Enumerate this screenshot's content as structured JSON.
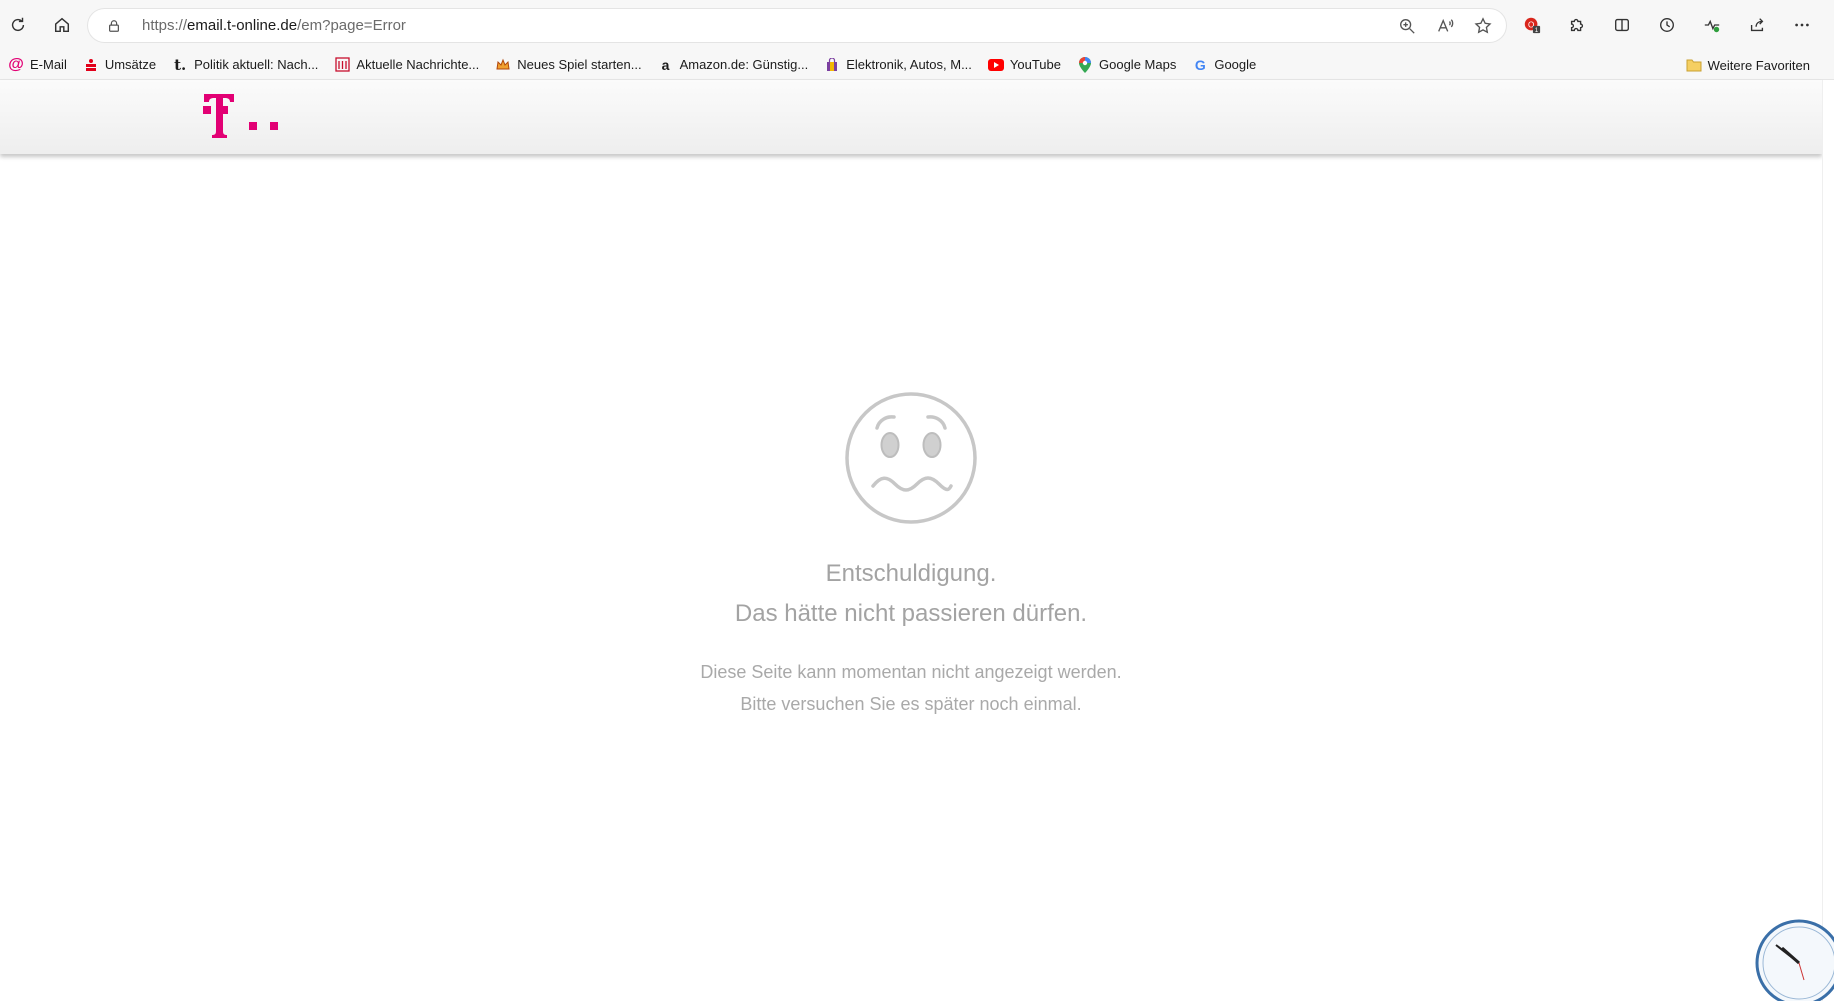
{
  "browser": {
    "url_scheme": "https://",
    "url_host": "email.t-online.de",
    "url_path": "/em?page=Error"
  },
  "favorites": [
    {
      "label": "E-Mail",
      "icon": "at-icon",
      "color": "#e20074"
    },
    {
      "label": "Umsätze",
      "icon": "sparkasse-icon",
      "color": "#e2001a"
    },
    {
      "label": "Politik aktuell: Nach...",
      "icon": "t-news-icon",
      "color": "#1b1b1b"
    },
    {
      "label": "Aktuelle Nachrichte...",
      "icon": "building-icon",
      "color": "#c8102e"
    },
    {
      "label": "Neues Spiel starten...",
      "icon": "crown-icon",
      "color": "#d4570f"
    },
    {
      "label": "Amazon.de: Günstig...",
      "icon": "amazon-icon",
      "color": "#1b1b1b"
    },
    {
      "label": "Elektronik, Autos, M...",
      "icon": "shopping-bag-icon",
      "color": "#7b3fa0"
    },
    {
      "label": "YouTube",
      "icon": "youtube-icon",
      "color": "#ff0000"
    },
    {
      "label": "Google Maps",
      "icon": "map-pin-icon",
      "color": "#34a853"
    },
    {
      "label": "Google",
      "icon": "google-icon",
      "color": "#4285f4"
    }
  ],
  "favorites_folder": {
    "label": "Weitere Favoriten",
    "icon": "folder-icon"
  },
  "brand": {
    "color": "#e20074"
  },
  "error": {
    "title": "Entschuldigung.",
    "subtitle": "Das hätte nicht passieren dürfen.",
    "message_line1": "Diese Seite kann momentan nicht angezeigt werden.",
    "message_line2": "Bitte versuchen Sie es später noch einmal."
  },
  "colors": {
    "text_muted": "#a3a3a3",
    "toolbar_bg": "#f7f7f7"
  }
}
